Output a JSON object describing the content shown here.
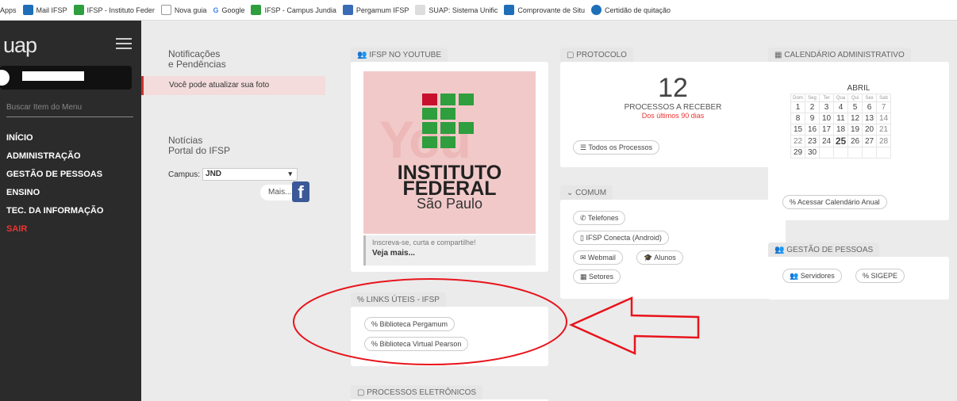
{
  "bookmarks": [
    {
      "label": "Apps",
      "color": "#ffffff"
    },
    {
      "label": "Mail IFSP",
      "color": "#1e6fb8"
    },
    {
      "label": "IFSP - Instituto Feder",
      "color": "#2e9e3e"
    },
    {
      "label": "Nova guia",
      "color": "#ffffff"
    },
    {
      "label": "Google",
      "color": "#ffffff"
    },
    {
      "label": "IFSP - Campus Jundia",
      "color": "#2e9e3e"
    },
    {
      "label": "Pergamum IFSP",
      "color": "#3a6bb5"
    },
    {
      "label": "SUAP: Sistema Unific",
      "color": "#ffffff"
    },
    {
      "label": "Comprovante de Situ",
      "color": "#1e6fb8"
    },
    {
      "label": "Certidão de quitação",
      "color": "#1e6fb8"
    }
  ],
  "sidebar": {
    "logo": "uap",
    "search_placeholder": "Buscar Item do Menu",
    "menu": [
      "INÍCIO",
      "ADMINISTRAÇÃO",
      "GESTÃO DE PESSOAS",
      "ENSINO",
      "TEC. DA INFORMAÇÃO",
      "SAIR"
    ]
  },
  "left": {
    "notif_title1": "Notificações",
    "notif_title2": "e Pendências",
    "notif_item": "Você pode atualizar sua foto",
    "news_title1": "Notícias",
    "news_title2": "Portal do IFSP",
    "campus_label": "Campus:",
    "campus_value": "JND",
    "more_label": "Mais...",
    "fb_letter": "f"
  },
  "youtube": {
    "tag": "IFSP NO YOUTUBE",
    "inst1": "INSTITUTO",
    "inst2": "FEDERAL",
    "place": "São Paulo",
    "caption": "Inscreva-se, curta e compartilhe!",
    "more": "Veja mais..."
  },
  "links": {
    "tag": "LINKS ÚTEIS - IFSP",
    "items": [
      "Biblioteca Pergamum",
      "Biblioteca Virtual Pearson"
    ]
  },
  "processos_eletronicos": {
    "tag": "PROCESSOS ELETRÔNICOS"
  },
  "protocolo": {
    "tag": "PROTOCOLO",
    "count": "12",
    "label": "PROCESSOS A RECEBER",
    "sub": "Dos últimos 90 dias",
    "button": "Todos os Processos"
  },
  "comum": {
    "tag": "COMUM",
    "buttons": [
      "Telefones",
      "IFSP Conecta (Android)",
      "Webmail",
      "Alunos",
      "Setores"
    ]
  },
  "calendario": {
    "tag": "CALENDÁRIO ADMINISTRATIVO",
    "month": "ABRIL",
    "weekdays": [
      "Dom",
      "Seg",
      "Ter",
      "Qua",
      "Qui",
      "Sex",
      "Sab"
    ],
    "weeks": [
      [
        "1",
        "2",
        "3",
        "4",
        "5",
        "6",
        "7"
      ],
      [
        "8",
        "9",
        "10",
        "11",
        "12",
        "13",
        "14"
      ],
      [
        "15",
        "16",
        "17",
        "18",
        "19",
        "20",
        "21"
      ],
      [
        "22",
        "23",
        "24",
        "25",
        "26",
        "27",
        "28"
      ],
      [
        "29",
        "30",
        "",
        "",
        "",
        "",
        ""
      ]
    ],
    "button": "Acessar Calendário Anual"
  },
  "gestao": {
    "tag": "GESTÃO DE PESSOAS",
    "buttons": [
      "Servidores",
      "SIGEPE"
    ]
  },
  "colors": {
    "annotation": "#e8141c",
    "sidebar": "#2b2b2b",
    "accent_red": "#e33333"
  }
}
